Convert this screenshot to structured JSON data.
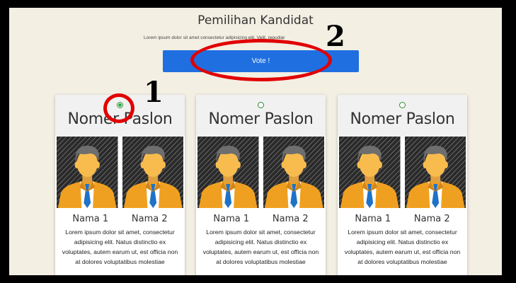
{
  "page": {
    "title": "Pemilihan Kandidat",
    "subtitle": "Lorem ipsum dolor sit amet consectetur adipisicing elit. Velit, repudiar",
    "vote_label": "Vote !"
  },
  "annotations": {
    "one": "1",
    "two": "2"
  },
  "cards": [
    {
      "title": "Nomer Paslon",
      "selected": true,
      "name1": "Nama 1",
      "name2": "Nama 2",
      "description": "Lorem ipsum dolor sit amet, consectetur adipisicing elit. Natus distinctio ex voluptates, autem earum ut, est officia non at dolores voluptatibus molestiae"
    },
    {
      "title": "Nomer Paslon",
      "selected": false,
      "name1": "Nama 1",
      "name2": "Nama 2",
      "description": "Lorem ipsum dolor sit amet, consectetur adipisicing elit. Natus distinctio ex voluptates, autem earum ut, est officia non at dolores voluptatibus molestiae"
    },
    {
      "title": "Nomer Paslon",
      "selected": false,
      "name1": "Nama 1",
      "name2": "Nama 2",
      "description": "Lorem ipsum dolor sit amet, consectetur adipisicing elit. Natus distinctio ex voluptates, autem earum ut, est officia non at dolores voluptatibus molestiae"
    }
  ],
  "colors": {
    "background": "#f3efe3",
    "button": "#1f6fe0",
    "annotation": "#e10000",
    "radio_selected": "#2fa84a",
    "suit": "#f0a020",
    "tie": "#1e73c8",
    "hair": "#6e6e6e",
    "skin": "#f8bc4e"
  }
}
